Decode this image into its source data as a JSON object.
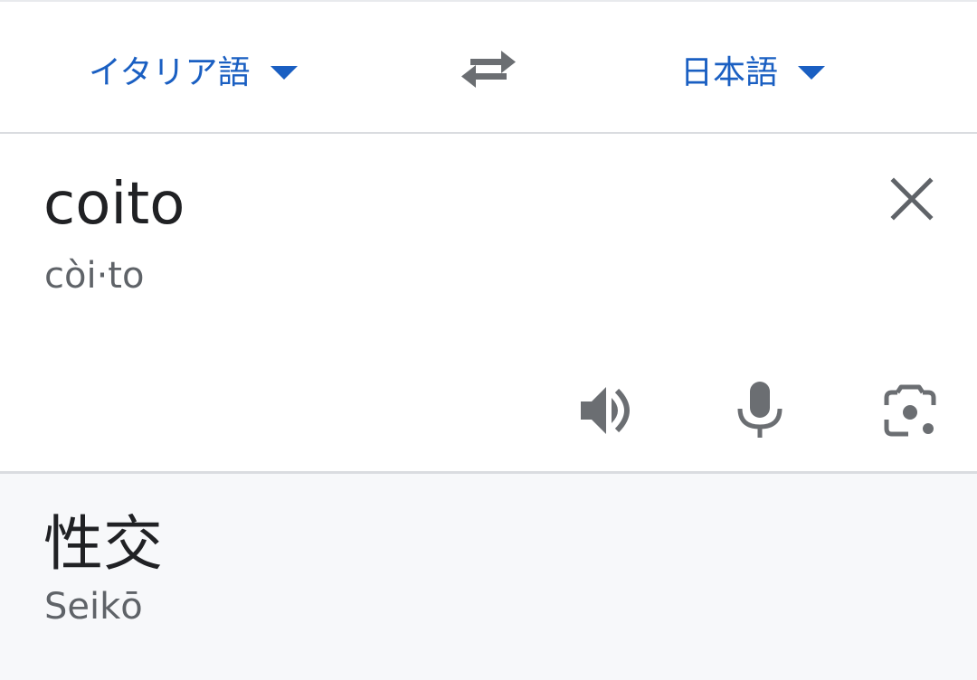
{
  "language_bar": {
    "source_language": "イタリア語",
    "target_language": "日本語",
    "swap_icon": "swap-arrows-icon",
    "dropdown_icon": "caret-down-icon",
    "accent_color": "#1a5fc2"
  },
  "input": {
    "source_text": "coito",
    "source_phonetic": "còi·to",
    "clear_icon": "close-icon",
    "tools": [
      {
        "name": "speaker-icon"
      },
      {
        "name": "microphone-icon"
      },
      {
        "name": "camera-lens-icon"
      }
    ]
  },
  "output": {
    "translated_text": "性交",
    "translated_phonetic": "Seikō"
  }
}
